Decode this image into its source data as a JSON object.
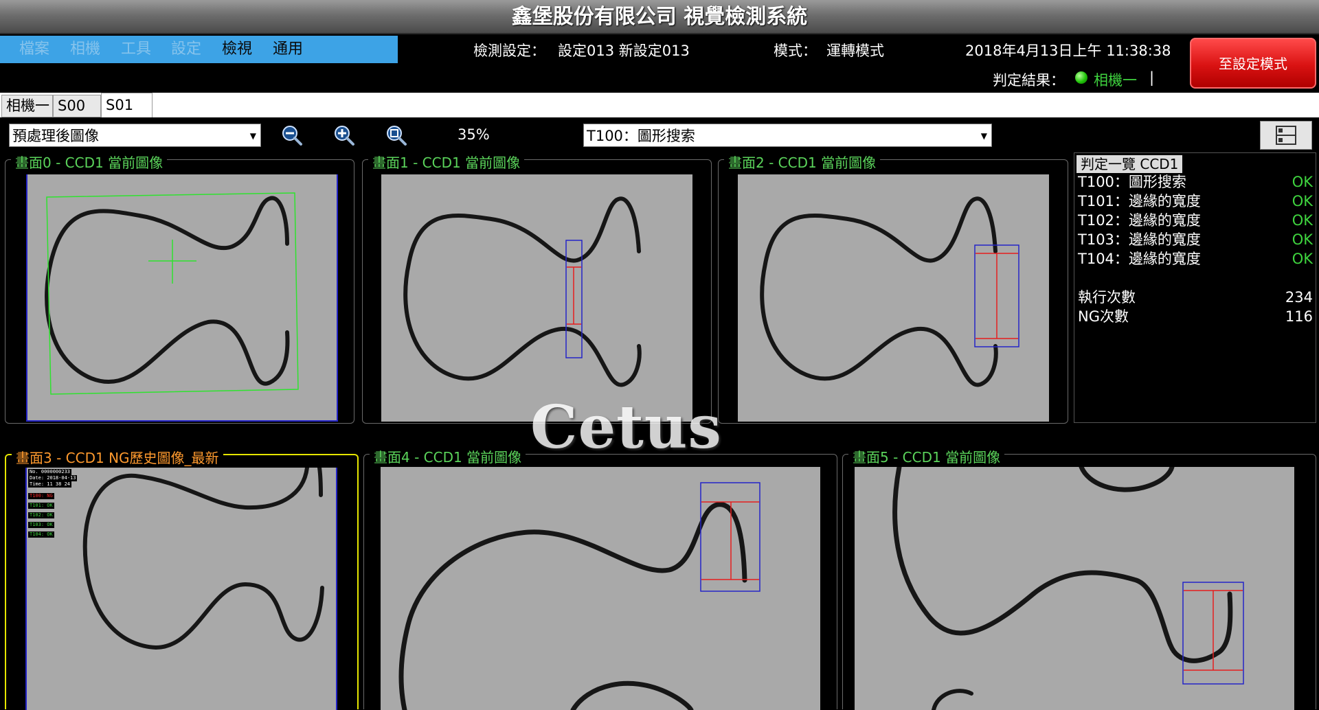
{
  "window": {
    "title": "鑫堡股份有限公司  視覺檢測系統"
  },
  "menu": [
    {
      "label": "檔案",
      "enabled": false
    },
    {
      "label": "相機",
      "enabled": false
    },
    {
      "label": "工具",
      "enabled": false
    },
    {
      "label": "設定",
      "enabled": false
    },
    {
      "label": "檢視",
      "enabled": true
    },
    {
      "label": "通用",
      "enabled": true
    }
  ],
  "header": {
    "inspection_label": "檢測設定：",
    "inspection_value": "設定013  新設定013",
    "mode_label": "模式：",
    "mode_value": "運轉模式",
    "datetime": "2018年4月13日上午 11:38:38",
    "result_label": "判定結果：",
    "result_camera": "相機一",
    "result_cursor": "|",
    "mode_button": "至設定模式"
  },
  "tabs": [
    {
      "label": "相機一",
      "active": false
    },
    {
      "label": "S00",
      "active": false
    },
    {
      "label": "S01",
      "active": true
    }
  ],
  "toolbar": {
    "image_select": "預處理後圖像",
    "zoom_value": "35%",
    "tool_select": "T100：圖形搜索",
    "icons": [
      "zoom-out-icon",
      "zoom-in-icon",
      "zoom-fit-icon",
      "layout-icon"
    ]
  },
  "panels": [
    {
      "title": "畫面0 - CCD1 當前圖像",
      "color": "green"
    },
    {
      "title": "畫面1 - CCD1 當前圖像",
      "color": "green"
    },
    {
      "title": "畫面2 - CCD1 當前圖像",
      "color": "green"
    },
    {
      "title": "畫面3 - CCD1 NG歷史圖像_最新",
      "color": "orange"
    },
    {
      "title": "畫面4 - CCD1 當前圖像",
      "color": "green"
    },
    {
      "title": "畫面5 - CCD1 當前圖像",
      "color": "green"
    }
  ],
  "results": {
    "title": "判定一覽 CCD1",
    "items": [
      {
        "name": "T100：圖形搜索",
        "status": "OK"
      },
      {
        "name": "T101：邊緣的寬度",
        "status": "OK"
      },
      {
        "name": "T102：邊緣的寬度",
        "status": "OK"
      },
      {
        "name": "T103：邊緣的寬度",
        "status": "OK"
      },
      {
        "name": "T104：邊緣的寬度",
        "status": "OK"
      }
    ],
    "run_count_label": "執行次數",
    "run_count": "234",
    "ng_count_label": "NG次數",
    "ng_count": "116"
  },
  "ng_overlay": {
    "lines": [
      "No. 0000000233",
      "Date: 2018-04-13",
      "Time: 11 38 24"
    ],
    "results": [
      {
        "text": "T100: NG",
        "ok": false
      },
      {
        "text": "T101: OK",
        "ok": true
      },
      {
        "text": "T102: OK",
        "ok": true
      },
      {
        "text": "T103: OK",
        "ok": true
      },
      {
        "text": "T104: OK",
        "ok": true
      }
    ]
  },
  "watermark": "Cetus",
  "colors": {
    "ok": "#3fd43f",
    "ng": "#ff2a2a",
    "menu_bg": "#3da3e6",
    "mode_button": "#d91212",
    "panel_title": "#5bd45b",
    "ng_title": "#ff9a2e"
  }
}
